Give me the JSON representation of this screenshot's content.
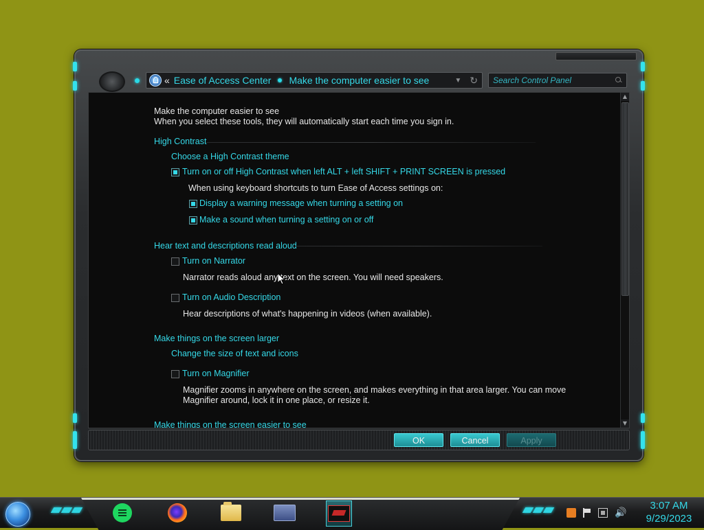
{
  "window": {
    "breadcrumb": [
      "Ease of Access Center",
      "Make the computer easier to see"
    ],
    "search_placeholder": "Search Control Panel",
    "accent_color": "#35d9e8"
  },
  "content": {
    "heading": "Make the computer easier to see",
    "subheading": "When you select these tools, they will automatically start each time you sign in.",
    "high_contrast": {
      "section": "High Contrast",
      "choose_link": "Choose a High Contrast theme",
      "toggle_shortcut": {
        "label": "Turn on or off High Contrast when left ALT + left SHIFT + PRINT SCREEN is pressed",
        "checked": true
      },
      "shortcut_note": "When using keyboard shortcuts to turn Ease of Access settings on:",
      "warning": {
        "label": "Display a warning message when turning a setting on",
        "checked": true
      },
      "sound": {
        "label": "Make a sound when turning a setting on or off",
        "checked": true
      }
    },
    "narrator": {
      "section": "Hear text and descriptions read aloud",
      "narrator_toggle": {
        "label": "Turn on Narrator",
        "checked": false
      },
      "narrator_desc": "Narrator reads aloud any text on the screen. You will need speakers.",
      "audio_toggle": {
        "label": "Turn on Audio Description",
        "checked": false
      },
      "audio_desc": "Hear descriptions of what's happening in videos (when available)."
    },
    "larger": {
      "section": "Make things on the screen larger",
      "size_link": "Change the size of text and icons",
      "magnifier_toggle": {
        "label": "Turn on Magnifier",
        "checked": false
      },
      "magnifier_desc_1": "Magnifier zooms in anywhere on the screen, and makes everything in that area larger. You can move",
      "magnifier_desc_2": "Magnifier around, lock it in one place, or resize it."
    },
    "next_section": "Make things on the screen easier to see"
  },
  "buttons": {
    "ok": "OK",
    "cancel": "Cancel",
    "apply": "Apply"
  },
  "taskbar": {
    "apps": [
      "chat-app-icon",
      "firefox-icon",
      "file-explorer-icon",
      "control-panel-icon",
      "ease-of-access-icon"
    ],
    "clock_time": "3:07 AM",
    "clock_date": "9/29/2023"
  }
}
